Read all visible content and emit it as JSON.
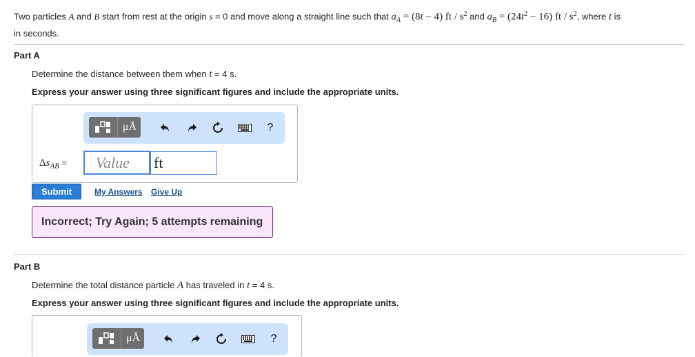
{
  "problem": {
    "p1": "Two particles ",
    "A": "A",
    "and": " and ",
    "B": "B",
    "p2": " start from rest at the origin ",
    "s": "s",
    "p3": " = 0 and move along a straight line such that ",
    "aA_eq": "a",
    "aA_sub": "A",
    "aA_expr": " = (8",
    "t1": "t",
    "aA_rest": " − 4) ft / s",
    "sq1": "2",
    "p4": " and ",
    "aB": "a",
    "aB_sub": "B",
    "aB_expr": " = (24",
    "t2": "t",
    "sq2": "2",
    "aB_rest": " − 16) ft / s",
    "sq3": "2",
    "p5": ", where ",
    "t3": "t",
    "p6": " is",
    "line2": "in seconds."
  },
  "partA": {
    "title": "Part A",
    "question_pre": "Determine the distance between them when ",
    "question_t": "t",
    "question_post": " = 4 s.",
    "instructions": "Express your answer using three significant figures and include the appropriate units.",
    "label_delta": "Δ",
    "label_s": "s",
    "label_sub": "AB",
    "label_eq": " =",
    "value_placeholder": "Value",
    "unit_value": "ft",
    "submit_label": "Submit",
    "my_answers_label": "My Answers",
    "give_up_label": "Give Up",
    "feedback": "Incorrect; Try Again; 5 attempts remaining"
  },
  "partB": {
    "title": "Part B",
    "question_pre": "Determine the total distance particle ",
    "question_A": "A",
    "question_mid": " has traveled in ",
    "question_t": "t",
    "question_post": " = 4 s.",
    "instructions": "Express your answer using three significant figures and include the appropriate units."
  },
  "toolbar": {
    "units_glyph": "μÅ",
    "help_glyph": "?"
  },
  "colors": {
    "toolbar_bg": "#cfe2fb",
    "submit_bg": "#2a7dd4",
    "feedback_bg": "#fbe6fc",
    "feedback_border": "#7a2a7e",
    "link": "#1a4e8c"
  },
  "icons": [
    "templates-icon",
    "units-icon",
    "undo-icon",
    "redo-icon",
    "reset-icon",
    "keyboard-icon",
    "help-icon"
  ]
}
